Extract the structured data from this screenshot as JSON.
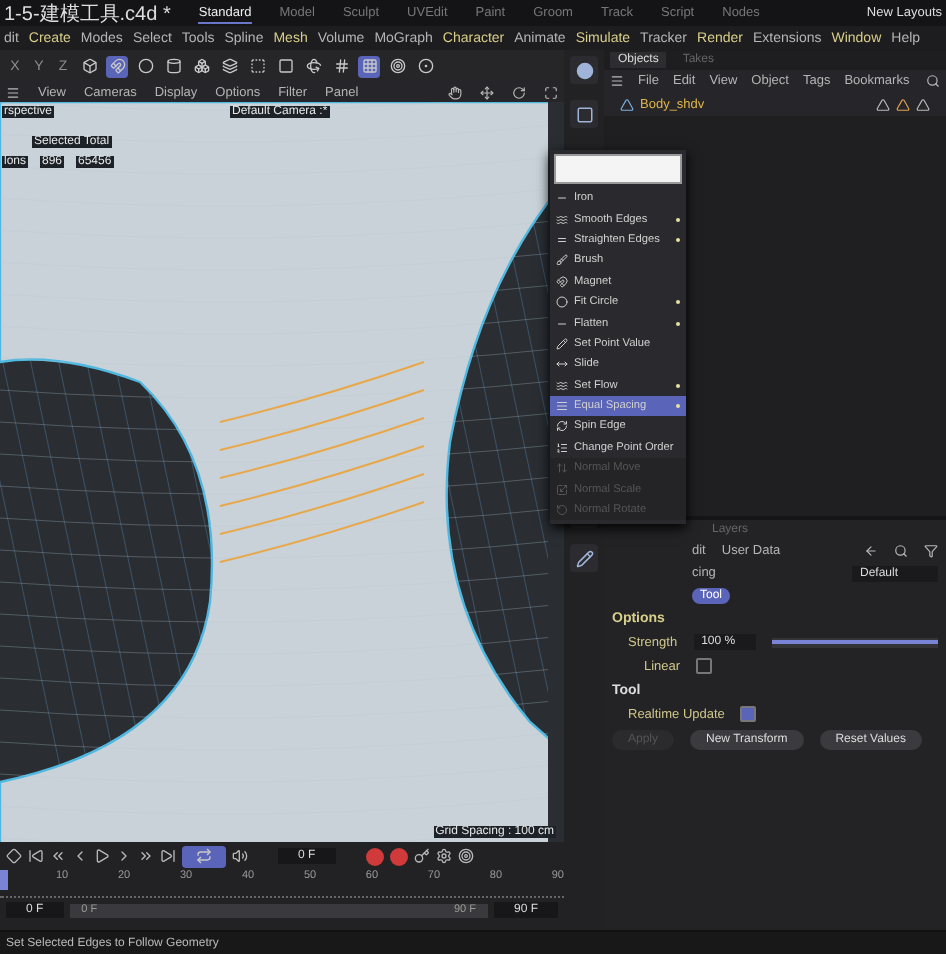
{
  "title_bar": {
    "document_tab": "1-5-建模工具.c4d *",
    "layouts": [
      {
        "label": "Standard",
        "selected": true
      },
      {
        "label": "Model",
        "selected": false
      },
      {
        "label": "Sculpt",
        "selected": false
      },
      {
        "label": "UVEdit",
        "selected": false
      },
      {
        "label": "Paint",
        "selected": false
      },
      {
        "label": "Groom",
        "selected": false
      },
      {
        "label": "Track",
        "selected": false
      },
      {
        "label": "Script",
        "selected": false
      },
      {
        "label": "Nodes",
        "selected": false
      }
    ],
    "new_layouts": "New Layouts"
  },
  "menu_bar": [
    "dit",
    "Create",
    "Modes",
    "Select",
    "Tools",
    "Spline",
    "Mesh",
    "Volume",
    "MoGraph",
    "Character",
    "Animate",
    "Simulate",
    "Tracker",
    "Render",
    "Extensions",
    "Window",
    "Help"
  ],
  "toolbar": {
    "axes": [
      "X",
      "Y",
      "Z"
    ],
    "tools": [
      {
        "selected": false
      },
      {
        "selected": true
      },
      {
        "selected": false
      },
      {
        "selected": false
      },
      {
        "selected": false
      },
      {
        "selected": false
      },
      {
        "selected": false
      },
      {
        "selected": false
      },
      {
        "selected": false
      },
      {
        "selected": false
      },
      {
        "selected": true
      },
      {
        "selected": false
      },
      {
        "selected": false
      }
    ]
  },
  "viewport": {
    "menu": [
      "View",
      "Cameras",
      "Display",
      "Options",
      "Filter",
      "Panel"
    ],
    "view_name": "rspective",
    "camera": "Default Camera :*",
    "stats_header": "Selected Total",
    "stats_label": "lons",
    "stats_selected": "896",
    "stats_total": "65456",
    "grid_spacing": "Grid Spacing : 100 cm"
  },
  "popup_menu": {
    "items": [
      {
        "label": "Iron",
        "dot": false,
        "selected": false,
        "disabled": false
      },
      {
        "label": "Smooth Edges",
        "dot": true,
        "selected": false,
        "disabled": false
      },
      {
        "label": "Straighten Edges",
        "dot": true,
        "selected": false,
        "disabled": false
      },
      {
        "label": "Brush",
        "dot": false,
        "selected": false,
        "disabled": false
      },
      {
        "label": "Magnet",
        "dot": false,
        "selected": false,
        "disabled": false
      },
      {
        "label": "Fit Circle",
        "dot": true,
        "selected": false,
        "disabled": false
      },
      {
        "label": "Flatten",
        "dot": true,
        "selected": false,
        "disabled": false
      },
      {
        "label": "Set Point Value",
        "dot": false,
        "selected": false,
        "disabled": false
      },
      {
        "label": "Slide",
        "dot": false,
        "selected": false,
        "disabled": false
      },
      {
        "label": "Set Flow",
        "dot": true,
        "selected": false,
        "disabled": false
      },
      {
        "label": "Equal Spacing",
        "dot": true,
        "selected": true,
        "disabled": false
      },
      {
        "label": "Spin Edge",
        "dot": false,
        "selected": false,
        "disabled": false
      },
      {
        "label": "Change Point Order",
        "dot": false,
        "selected": false,
        "disabled": false
      },
      {
        "label": "Normal Move",
        "dot": false,
        "selected": false,
        "disabled": true
      },
      {
        "label": "Normal Scale",
        "dot": false,
        "selected": false,
        "disabled": true
      },
      {
        "label": "Normal Rotate",
        "dot": false,
        "selected": false,
        "disabled": true
      }
    ]
  },
  "objects_panel": {
    "tabs": [
      {
        "label": "Objects",
        "selected": true
      },
      {
        "label": "Takes",
        "selected": false
      }
    ],
    "menu": [
      "File",
      "Edit",
      "View",
      "Object",
      "Tags",
      "Bookmarks"
    ],
    "object": "Body_shdv"
  },
  "attributes": {
    "tab": "Layers",
    "menu": [
      "dit",
      "User Data"
    ],
    "mode": "cing",
    "preset": "Default",
    "tool_tab": {
      "label": "Tool",
      "selected": true
    },
    "options_header": "Options",
    "strength": {
      "label": "Strength",
      "value": "100 %",
      "level": 1
    },
    "linear": {
      "label": "Linear",
      "checked": false
    },
    "tool_header": "Tool",
    "realtime": {
      "label": "Realtime Update",
      "checked": true
    },
    "buttons": [
      {
        "label": "Apply",
        "disabled": true
      },
      {
        "label": "New Transform",
        "disabled": false
      },
      {
        "label": "Reset Values",
        "disabled": false
      }
    ]
  },
  "timeline": {
    "frame": "0 F",
    "loop_on": true,
    "ruler": [
      "10",
      "20",
      "30",
      "40",
      "50",
      "60",
      "70",
      "80",
      "90"
    ],
    "start": "0 F",
    "range_start": "0 F",
    "range_end": "90 F",
    "end": "90 F"
  },
  "status_bar": "Set Selected Edges to Follow Geometry"
}
